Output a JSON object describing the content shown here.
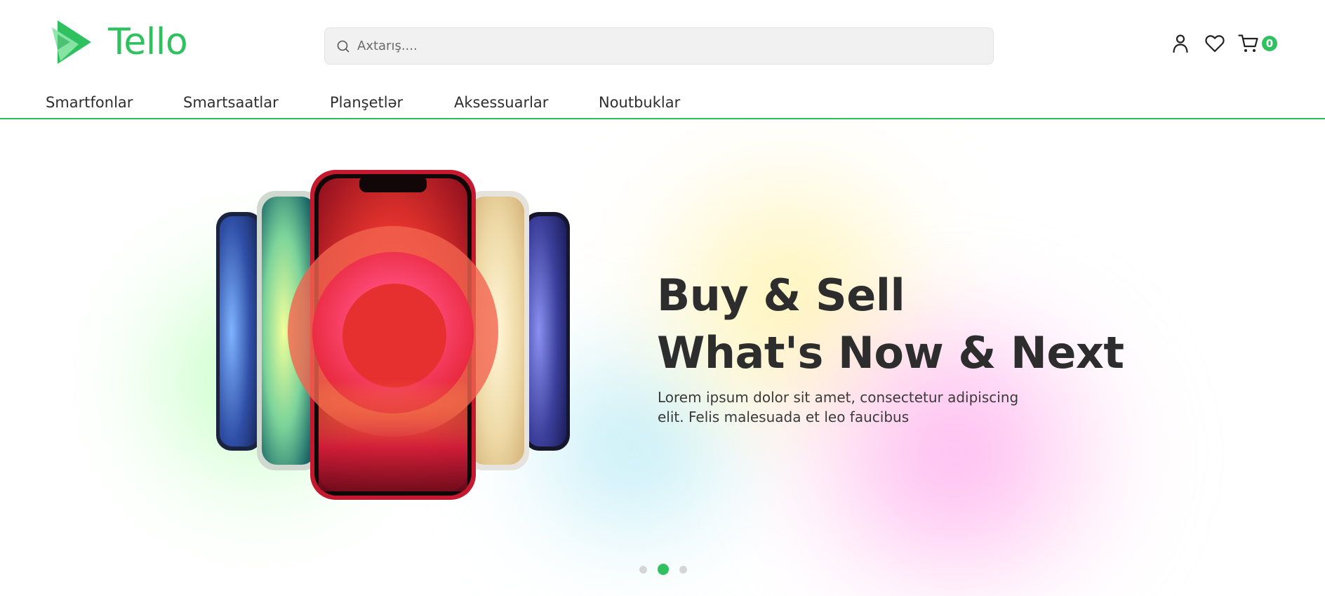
{
  "header": {
    "logo_text": "Tello",
    "search": {
      "placeholder": "Axtarış...."
    },
    "cart_count": "0",
    "icons": [
      "search-icon",
      "user-icon",
      "heart-icon",
      "cart-icon"
    ]
  },
  "nav": {
    "items": [
      {
        "label": "Smartfonlar"
      },
      {
        "label": "Smartsaatlar"
      },
      {
        "label": "Planşetlər"
      },
      {
        "label": "Aksessuarlar"
      },
      {
        "label": "Noutbuklar"
      }
    ]
  },
  "hero": {
    "title_line1": "Buy & Sell",
    "title_line2": "What's Now & Next",
    "text": "Lorem ipsum dolor sit amet, consectetur adipiscing elit. Felis malesuada et leo faucibus",
    "slides": {
      "count": 3,
      "active": 2
    }
  },
  "colors": {
    "brand": "#2fc15f",
    "text": "#2d2d2d"
  }
}
